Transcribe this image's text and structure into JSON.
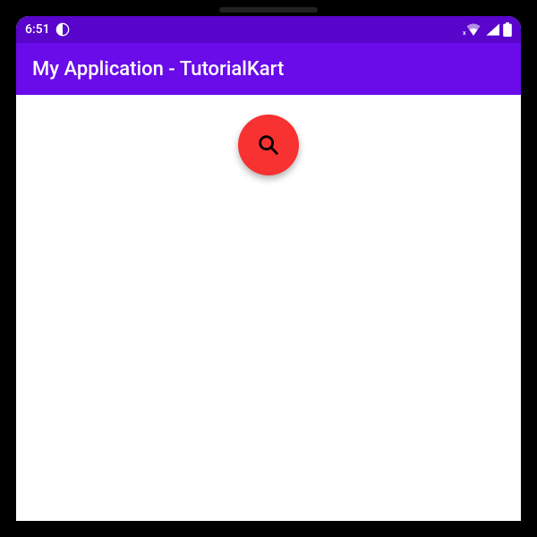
{
  "status": {
    "time": "6:51",
    "icons": {
      "info": "info-icon",
      "sd": "sd-card-icon",
      "wifi": "wifi-icon",
      "wifi_x": "x",
      "signal": "signal-icon",
      "battery": "battery-icon"
    }
  },
  "app": {
    "title": "My Application - TutorialKart"
  },
  "fab": {
    "icon_name": "search-icon",
    "color": "#f83131"
  }
}
